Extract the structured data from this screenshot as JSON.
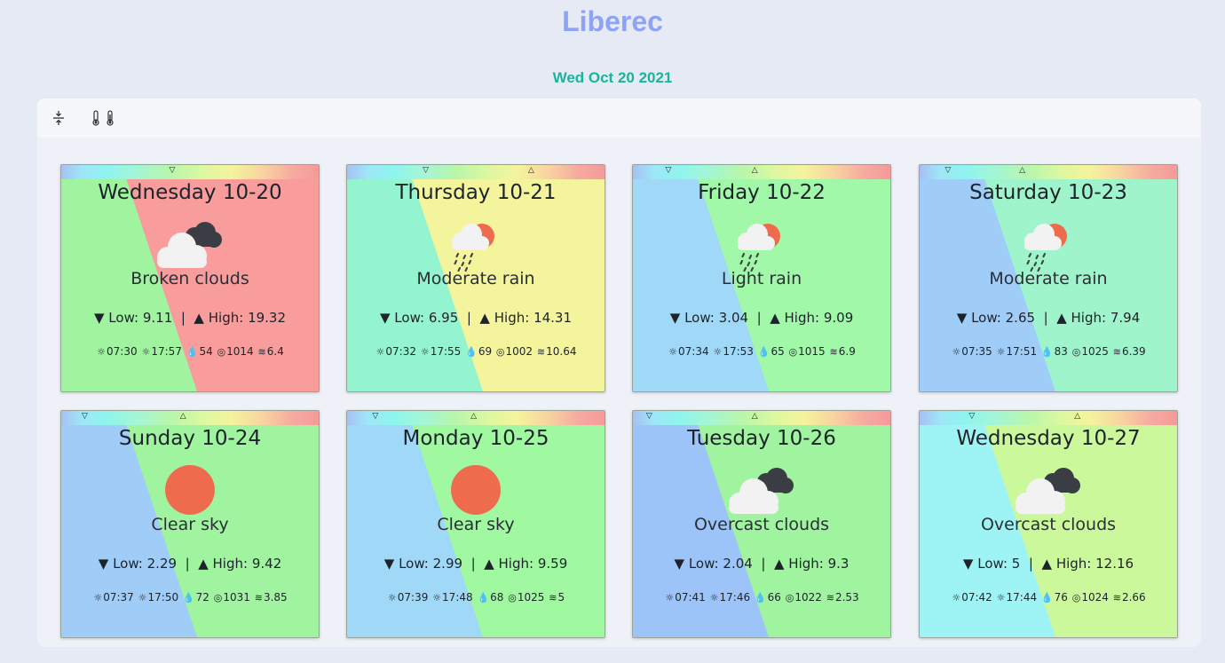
{
  "location": {
    "city": "Liberec"
  },
  "current_date": "Wed Oct 20 2021",
  "toolbar": {
    "collapse_icon": "⊹",
    "thermometer_icon": "🌡"
  },
  "symbols": {
    "low": "▼",
    "high": "▲",
    "sep": "|",
    "low_label": "Low:",
    "high_label": "High:",
    "sunrise": "☼",
    "sunset": "☼",
    "humidity": "💧",
    "pressure": "◎",
    "wind": "≋"
  },
  "forecast": [
    {
      "day": "Wednesday 10-20",
      "description": "Broken clouds",
      "icon": "broken-clouds-icon",
      "low": "9.11",
      "high": "19.32",
      "sunrise": "07:30",
      "sunset": "17:57",
      "humidity": "54",
      "pressure": "1014",
      "wind": "6.4",
      "low_frac": 0.43,
      "high_frac": 1.0,
      "left_color": "#a0f4a0",
      "right_color": "#f89c9c"
    },
    {
      "day": "Thursday 10-21",
      "description": "Moderate rain",
      "icon": "rain-sun-icon",
      "low": "6.95",
      "high": "14.31",
      "sunrise": "07:32",
      "sunset": "17:55",
      "humidity": "69",
      "pressure": "1002",
      "wind": "10.64",
      "low_frac": 0.28,
      "high_frac": 0.72,
      "left_color": "#94f4d0",
      "right_color": "#f4f49c"
    },
    {
      "day": "Friday 10-22",
      "description": "Light rain",
      "icon": "rain-sun-icon",
      "low": "3.04",
      "high": "9.09",
      "sunrise": "07:34",
      "sunset": "17:53",
      "humidity": "65",
      "pressure": "1015",
      "wind": "6.9",
      "low_frac": 0.1,
      "high_frac": 0.46,
      "left_color": "#a0d8f8",
      "right_color": "#a0f8a8"
    },
    {
      "day": "Saturday 10-23",
      "description": "Moderate rain",
      "icon": "rain-sun-icon",
      "low": "2.65",
      "high": "7.94",
      "sunrise": "07:35",
      "sunset": "17:51",
      "humidity": "83",
      "pressure": "1025",
      "wind": "6.39",
      "low_frac": 0.07,
      "high_frac": 0.38,
      "left_color": "#a0ccf8",
      "right_color": "#a0f4cc"
    },
    {
      "day": "Sunday 10-24",
      "description": "Clear sky",
      "icon": "sun-icon",
      "low": "2.29",
      "high": "9.42",
      "sunrise": "07:37",
      "sunset": "17:50",
      "humidity": "72",
      "pressure": "1031",
      "wind": "3.85",
      "low_frac": 0.05,
      "high_frac": 0.46,
      "left_color": "#a0ccf8",
      "right_color": "#a0f4a0"
    },
    {
      "day": "Monday 10-25",
      "description": "Clear sky",
      "icon": "sun-icon",
      "low": "2.99",
      "high": "9.59",
      "sunrise": "07:39",
      "sunset": "17:48",
      "humidity": "68",
      "pressure": "1025",
      "wind": "5",
      "low_frac": 0.07,
      "high_frac": 0.48,
      "left_color": "#a0d8f8",
      "right_color": "#a0f8a0"
    },
    {
      "day": "Tuesday 10-26",
      "description": "Overcast clouds",
      "icon": "overcast-clouds-icon",
      "low": "2.04",
      "high": "9.3",
      "sunrise": "07:41",
      "sunset": "17:46",
      "humidity": "66",
      "pressure": "1022",
      "wind": "2.53",
      "low_frac": 0.02,
      "high_frac": 0.46,
      "left_color": "#9cc4f8",
      "right_color": "#a0f4a0"
    },
    {
      "day": "Wednesday 10-27",
      "description": "Overcast clouds",
      "icon": "overcast-clouds-icon",
      "low": "5",
      "high": "12.16",
      "sunrise": "07:42",
      "sunset": "17:44",
      "humidity": "76",
      "pressure": "1024",
      "wind": "2.66",
      "low_frac": 0.17,
      "high_frac": 0.61,
      "left_color": "#9ef4f4",
      "right_color": "#ccf89c"
    }
  ]
}
